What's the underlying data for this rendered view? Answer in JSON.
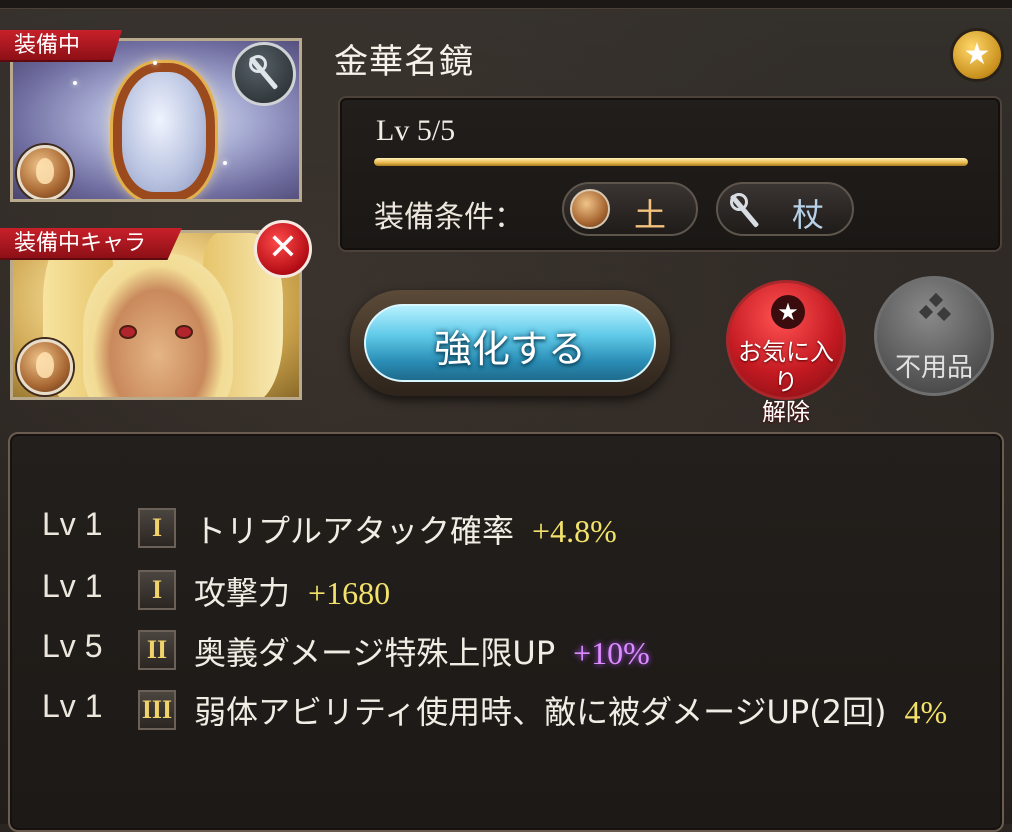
{
  "weapon": {
    "equipped_tag": "装備中",
    "name": "金華名鏡",
    "level_text": "Lv 5/5",
    "level_progress": 1.0
  },
  "character": {
    "equipped_tag": "装備中キャラ"
  },
  "requirements": {
    "label": "装備条件：",
    "element": "土",
    "weapon_type": "杖"
  },
  "buttons": {
    "enhance": "強化する",
    "unfavorite": "お気に入り解除",
    "unfavorite_line1": "お気に入り",
    "unfavorite_line2": "解除",
    "junk": "不用品"
  },
  "skills": [
    {
      "lv": "Lv 1",
      "tier": "I",
      "name": "トリプルアタック確率",
      "value": "+4.8%"
    },
    {
      "lv": "Lv 1",
      "tier": "I",
      "name": "攻撃力",
      "value": "+1680"
    },
    {
      "lv": "Lv 5",
      "tier": "II",
      "name": "奥義ダメージ特殊上限UP",
      "value": "+10%"
    },
    {
      "lv": "Lv 1",
      "tier": "III",
      "name": "弱体アビリティ使用時、敵に被ダメージUP(2回)",
      "value": "4%"
    }
  ],
  "colors": {
    "value_yellow": "#f2e16a",
    "value_purple": "#dd8cff",
    "tag_red": "#c8202a",
    "enhance_blue": "#5fc9e8"
  },
  "icons": {
    "element": "earth-element-icon",
    "weapon_type": "staff-icon",
    "favorite": "star-icon",
    "remove": "close-icon"
  }
}
